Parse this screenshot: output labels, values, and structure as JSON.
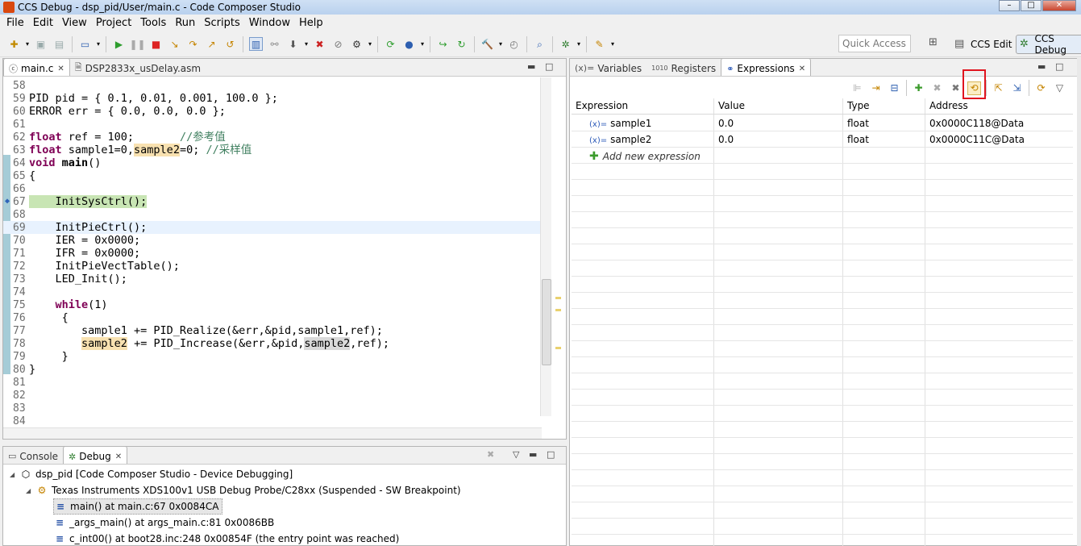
{
  "window": {
    "title": "CCS Debug - dsp_pid/User/main.c - Code Composer Studio"
  },
  "menu": [
    "File",
    "Edit",
    "View",
    "Project",
    "Tools",
    "Run",
    "Scripts",
    "Window",
    "Help"
  ],
  "toolbar": {
    "quick_access_placeholder": "Quick Access",
    "perspective_edit": "CCS Edit",
    "perspective_debug": "CCS Debug"
  },
  "editor": {
    "tabs": [
      {
        "label": "main.c",
        "active": true
      },
      {
        "label": "DSP2833x_usDelay.asm",
        "active": false
      }
    ],
    "lines": [
      {
        "n": "58",
        "t": ""
      },
      {
        "n": "59",
        "t": "PID pid = { 0.1, 0.01, 0.001, 100.0 };"
      },
      {
        "n": "60",
        "t": "ERROR err = { 0.0, 0.0, 0.0 };"
      },
      {
        "n": "61",
        "t": ""
      },
      {
        "n": "62",
        "t": "float ref = 100;       //参考值"
      },
      {
        "n": "63",
        "t": "float sample1=0,sample2=0; //采样值"
      },
      {
        "n": "64",
        "t": "void main()"
      },
      {
        "n": "65",
        "t": "{"
      },
      {
        "n": "66",
        "t": ""
      },
      {
        "n": "67",
        "t": "    InitSysCtrl();"
      },
      {
        "n": "68",
        "t": ""
      },
      {
        "n": "69",
        "t": "    InitPieCtrl();"
      },
      {
        "n": "70",
        "t": "    IER = 0x0000;"
      },
      {
        "n": "71",
        "t": "    IFR = 0x0000;"
      },
      {
        "n": "72",
        "t": "    InitPieVectTable();"
      },
      {
        "n": "73",
        "t": "    LED_Init();"
      },
      {
        "n": "74",
        "t": ""
      },
      {
        "n": "75",
        "t": "    while(1)"
      },
      {
        "n": "76",
        "t": "     {"
      },
      {
        "n": "77",
        "t": "        sample1 += PID_Realize(&err,&pid,sample1,ref);"
      },
      {
        "n": "78",
        "t": "        sample2 += PID_Increase(&err,&pid,sample2,ref);"
      },
      {
        "n": "79",
        "t": "     }"
      },
      {
        "n": "80",
        "t": "}"
      },
      {
        "n": "81",
        "t": ""
      },
      {
        "n": "82",
        "t": ""
      },
      {
        "n": "83",
        "t": ""
      },
      {
        "n": "84",
        "t": ""
      }
    ]
  },
  "debug_panel": {
    "tabs": [
      "Console",
      "Debug"
    ],
    "tree": [
      {
        "label": "dsp_pid [Code Composer Studio - Device Debugging]",
        "icon": "debug-session-icon"
      },
      {
        "label": "Texas Instruments XDS100v1 USB Debug Probe/C28xx (Suspended - SW Breakpoint)",
        "icon": "target-icon"
      },
      {
        "label": "main() at main.c:67 0x0084CA",
        "icon": "stack-frame-icon"
      },
      {
        "label": "_args_main() at args_main.c:81 0x0086BB",
        "icon": "stack-frame-icon"
      },
      {
        "label": "c_int00() at boot28.inc:248 0x00854F  (the entry point was reached)",
        "icon": "stack-frame-icon"
      }
    ]
  },
  "expressions_panel": {
    "tabs": [
      "Variables",
      "Registers",
      "Expressions"
    ],
    "columns": [
      "Expression",
      "Value",
      "Type",
      "Address"
    ],
    "rows": [
      {
        "expression": "sample1",
        "value": "0.0",
        "type": "float",
        "address": "0x0000C118@Data"
      },
      {
        "expression": "sample2",
        "value": "0.0",
        "type": "float",
        "address": "0x0000C11C@Data"
      }
    ],
    "add_new": "Add new expression",
    "highlight_color": "#e0141e"
  }
}
